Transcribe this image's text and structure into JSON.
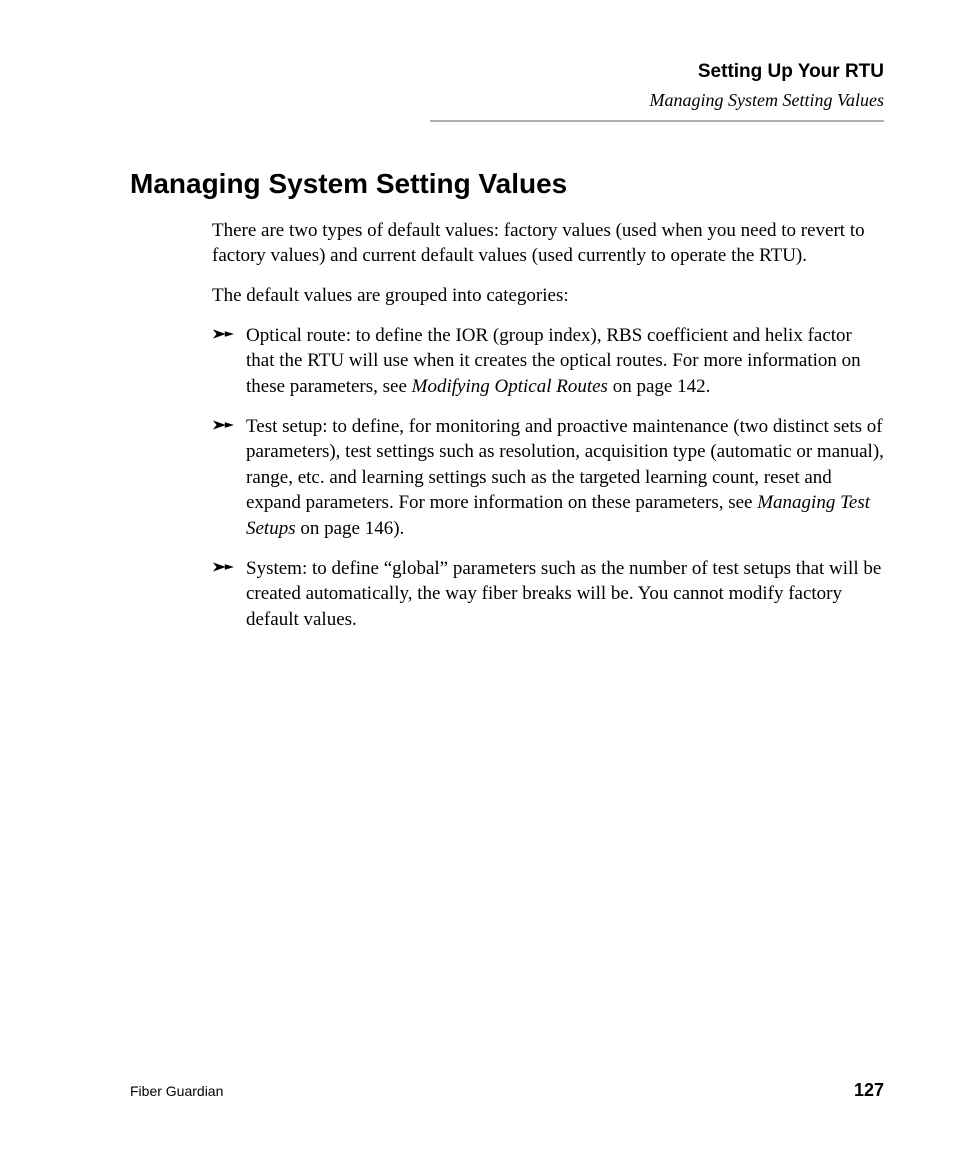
{
  "header": {
    "chapter": "Setting Up Your RTU",
    "section": "Managing System Setting Values"
  },
  "title": "Managing System Setting Values",
  "intro_para": "There are two types of default values: factory values (used when you need to revert to factory values) and current default values (used currently to operate the RTU).",
  "group_para": "The default values are grouped into categories:",
  "bullets": [
    {
      "pre": "Optical route: to define the IOR (group index), RBS coefficient and helix factor that the RTU will use when it creates the optical routes. For more information on these parameters, see ",
      "em": "Modifying Optical Routes",
      "post": " on page 142."
    },
    {
      "pre": "Test setup: to define, for monitoring and proactive maintenance (two distinct sets of parameters), test settings such as resolution, acquisition type (automatic or manual), range, etc. and learning settings such as the targeted learning count, reset and expand parameters. For more information on these parameters, see ",
      "em": "Managing Test Setups",
      "post": " on page 146)."
    },
    {
      "pre": "System: to define “global” parameters such as the number of test setups that will be created automatically, the way fiber breaks will be. You cannot modify factory default values.",
      "em": "",
      "post": ""
    }
  ],
  "footer": {
    "product": "Fiber Guardian",
    "page": "127"
  }
}
